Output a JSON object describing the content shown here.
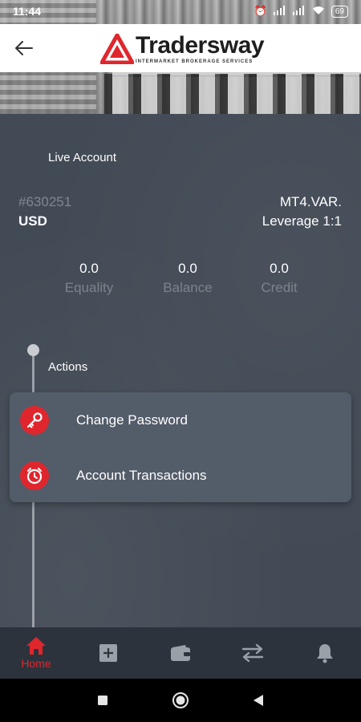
{
  "status_bar": {
    "time": "11:44",
    "battery": "69"
  },
  "header": {
    "back_icon": "arrow-left-icon",
    "logo_text": "Tradersway",
    "logo_subtitle": "INTERMARKET BROKERAGE SERVICES"
  },
  "account": {
    "type": "Live Account",
    "number": "#630251",
    "currency": "USD",
    "platform": "MT4.VAR.",
    "leverage": "Leverage 1:1"
  },
  "stats": [
    {
      "value": "0.0",
      "label": "Equality"
    },
    {
      "value": "0.0",
      "label": "Balance"
    },
    {
      "value": "0.0",
      "label": "Credit"
    }
  ],
  "actions": {
    "title": "Actions",
    "items": [
      {
        "label": "Change Password",
        "icon": "key-icon"
      },
      {
        "label": "Account Transactions",
        "icon": "clock-icon"
      }
    ]
  },
  "tabbar": {
    "items": [
      {
        "label": "Home",
        "icon": "home-icon",
        "active": true
      },
      {
        "label": "",
        "icon": "plus-square-icon",
        "active": false
      },
      {
        "label": "",
        "icon": "wallet-icon",
        "active": false
      },
      {
        "label": "",
        "icon": "transfer-icon",
        "active": false
      },
      {
        "label": "",
        "icon": "bell-icon",
        "active": false
      }
    ]
  },
  "colors": {
    "accent": "#e0262d",
    "background": "#424a55",
    "card": "#535c69",
    "tabbar": "#2c333c"
  }
}
